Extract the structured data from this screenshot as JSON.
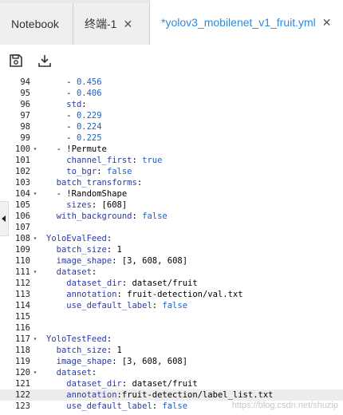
{
  "tabs": [
    {
      "label": "Notebook",
      "closable": false,
      "active": false
    },
    {
      "label": "终端-1",
      "closable": true,
      "active": false
    },
    {
      "label": "*yolov3_mobilenet_v1_fruit.yml",
      "closable": true,
      "active": true
    }
  ],
  "toolbar": {
    "save_icon": "save-icon",
    "download_icon": "download-icon"
  },
  "editor": {
    "lines": [
      {
        "num": "94",
        "fold": false,
        "text": "    - 0.456"
      },
      {
        "num": "95",
        "fold": false,
        "text": "    - 0.406"
      },
      {
        "num": "96",
        "fold": false,
        "text": "    std:"
      },
      {
        "num": "97",
        "fold": false,
        "text": "    - 0.229"
      },
      {
        "num": "98",
        "fold": false,
        "text": "    - 0.224"
      },
      {
        "num": "99",
        "fold": false,
        "text": "    - 0.225"
      },
      {
        "num": "100",
        "fold": true,
        "text": "  - !Permute"
      },
      {
        "num": "101",
        "fold": false,
        "text": "    channel_first: true"
      },
      {
        "num": "102",
        "fold": false,
        "text": "    to_bgr: false"
      },
      {
        "num": "103",
        "fold": false,
        "text": "  batch_transforms:"
      },
      {
        "num": "104",
        "fold": true,
        "text": "  - !RandomShape"
      },
      {
        "num": "105",
        "fold": false,
        "text": "    sizes: [608]"
      },
      {
        "num": "106",
        "fold": false,
        "text": "  with_background: false"
      },
      {
        "num": "107",
        "fold": false,
        "text": ""
      },
      {
        "num": "108",
        "fold": true,
        "text": "YoloEvalFeed:"
      },
      {
        "num": "109",
        "fold": false,
        "text": "  batch_size: 1"
      },
      {
        "num": "110",
        "fold": false,
        "text": "  image_shape: [3, 608, 608]"
      },
      {
        "num": "111",
        "fold": true,
        "text": "  dataset:"
      },
      {
        "num": "112",
        "fold": false,
        "text": "    dataset_dir: dataset/fruit"
      },
      {
        "num": "113",
        "fold": false,
        "text": "    annotation: fruit-detection/val.txt"
      },
      {
        "num": "114",
        "fold": false,
        "text": "    use_default_label: false"
      },
      {
        "num": "115",
        "fold": false,
        "text": ""
      },
      {
        "num": "116",
        "fold": false,
        "text": ""
      },
      {
        "num": "117",
        "fold": true,
        "text": "YoloTestFeed:"
      },
      {
        "num": "118",
        "fold": false,
        "text": "  batch_size: 1"
      },
      {
        "num": "119",
        "fold": false,
        "text": "  image_shape: [3, 608, 608]"
      },
      {
        "num": "120",
        "fold": true,
        "text": "  dataset:"
      },
      {
        "num": "121",
        "fold": false,
        "text": "    dataset_dir: dataset/fruit"
      },
      {
        "num": "122",
        "fold": false,
        "text": "    annotation:fruit-detection/label_list.txt",
        "current": true
      },
      {
        "num": "123",
        "fold": false,
        "text": "    use_default_label: false"
      }
    ]
  },
  "watermark": "https://blog.csdn.net/shuzip",
  "colors": {
    "active_tab": "#2f8ad8",
    "key": "#2b3aa0",
    "value": "#0b7a2b",
    "bool": "#1f5fbf"
  }
}
